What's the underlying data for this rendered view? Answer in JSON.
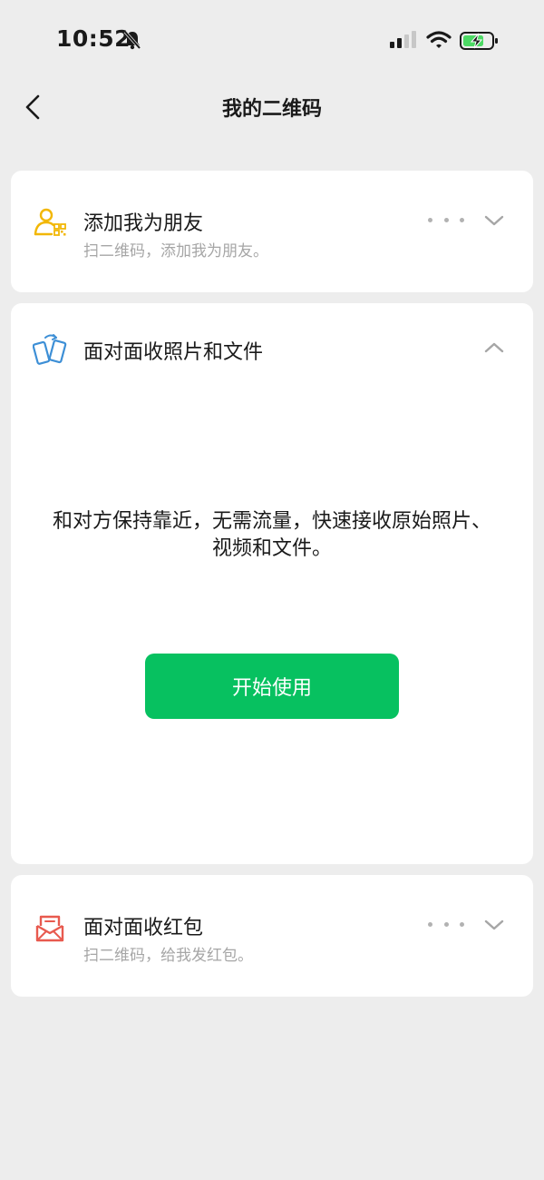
{
  "status_bar": {
    "time": "10:52",
    "icons": [
      "bell-muted-icon",
      "cellular-signal-icon",
      "wifi-icon",
      "battery-charging-icon"
    ]
  },
  "nav": {
    "title": "我的二维码",
    "back_icon": "chevron-left-icon"
  },
  "cards": [
    {
      "title": "添加我为朋友",
      "subtitle": "扫二维码，添加我为朋友。",
      "icon": "person-qr-icon",
      "icon_color": "#f2b705",
      "expanded": false
    },
    {
      "title": "面对面收照片和文件",
      "icon": "phones-transfer-icon",
      "icon_color": "#3d8fd6",
      "expanded": true,
      "description": "和对方保持靠近，无需流量，快速接收原始照片、视频和文件。",
      "button_label": "开始使用"
    },
    {
      "title": "面对面收红包",
      "subtitle": "扫二维码，给我发红包。",
      "icon": "red-packet-icon",
      "icon_color": "#e85a4f",
      "expanded": false
    }
  ],
  "colors": {
    "background": "#ededed",
    "card": "#ffffff",
    "primary_button": "#07c160",
    "subtitle_text": "#a6a6a6",
    "battery": "#4cd964"
  }
}
